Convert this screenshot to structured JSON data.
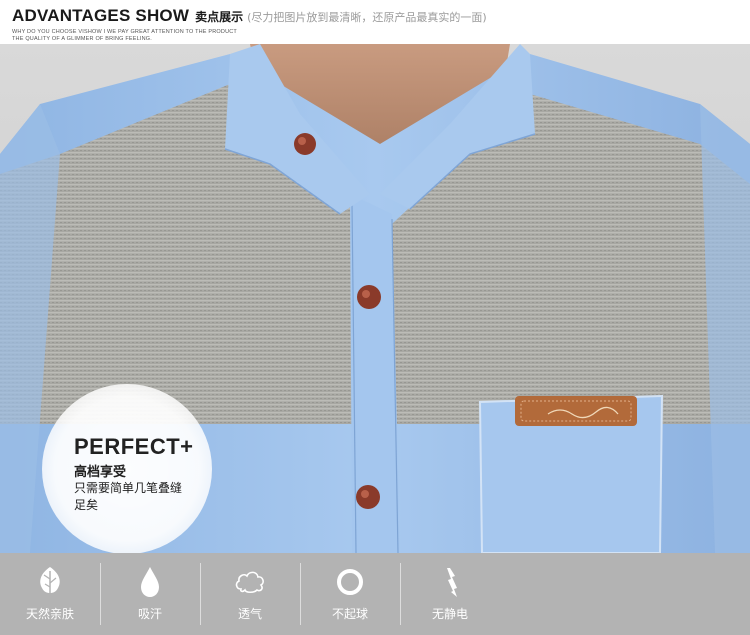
{
  "header": {
    "title_en": "ADVANTAGES SHOW",
    "title_cn": "卖点展示",
    "note": "(尽力把图片放到最清晰，还原产品最真实的一面)",
    "subtitle_line1": "WHY DO YOU CHOOSE VISHOW I WE PAY GREAT ATTENTION TO THE PRODUCT",
    "subtitle_line2": "THE QUALITY OF A GLIMMER OF BRING FEELING."
  },
  "badge": {
    "title": "PERFECT+",
    "line1": "高档享受",
    "line2": "只需要简单几笔叠缝",
    "line3": "足矣"
  },
  "features": [
    {
      "icon": "leaf-icon",
      "label": "天然亲肤"
    },
    {
      "icon": "water-drop-icon",
      "label": "吸汗"
    },
    {
      "icon": "cloud-icon",
      "label": "透气"
    },
    {
      "icon": "ring-icon",
      "label": "不起球"
    },
    {
      "icon": "lightning-icon",
      "label": "无静电"
    }
  ],
  "colors": {
    "shirt_blue": "#9ec1ea",
    "yoke_gray": "#a9a9a4",
    "button_brown": "#8a3a2a",
    "feature_bar": "#b3b3b3"
  }
}
